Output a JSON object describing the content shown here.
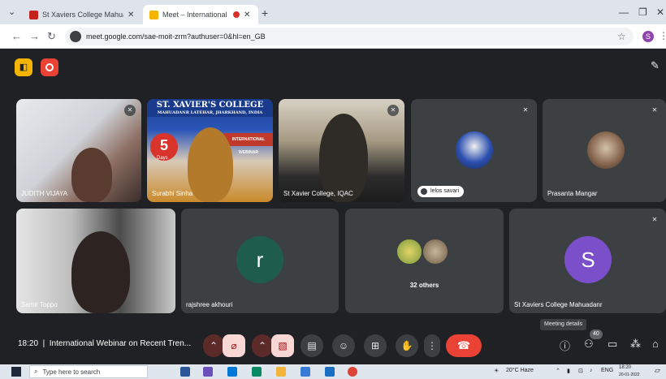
{
  "browser": {
    "tabs": [
      {
        "title": "St Xaviers College Mahuadanr |",
        "favicon_color": "#c5221f"
      },
      {
        "title": "Meet – International Webin",
        "favicon_color": "#f5b400",
        "active": true
      }
    ],
    "url": "meet.google.com/sae-moit-zrm?authuser=0&hl=en_GB"
  },
  "participants": [
    {
      "name": "JUDITH VIJAYA",
      "muted": true
    },
    {
      "name": "Surabhi Sinha",
      "muted": false
    },
    {
      "name": "St Xavier College, IQAC",
      "muted": true
    },
    {
      "name": "lelos savari",
      "muted": true
    },
    {
      "name": "Prasanta Mangar",
      "muted": true
    },
    {
      "name": "Samir Toppo",
      "muted": false
    },
    {
      "name": "rajshree akhouri",
      "initial": "r",
      "color": "#1e5c4e"
    },
    {
      "name": "32 others"
    },
    {
      "name": "St Xaviers College Mahuadanr",
      "initial": "S",
      "color": "#7b4fc9",
      "muted": true
    }
  ],
  "banner": {
    "title": "ST. XAVIER'S COLLEGE",
    "line1": "MAHUADANR",
    "line2": "LATEHAR, JHARKHAND, INDIA",
    "days_num": "5",
    "days_label": "Days",
    "intl": "INTERNATIONAL WEBINAR"
  },
  "bottom_bar": {
    "time": "18:20",
    "separator": "|",
    "meeting_title": "International Webinar on Recent Tren...",
    "tooltip": "Meeting details",
    "people_count": "40"
  },
  "taskbar": {
    "search_placeholder": "Type here to search",
    "weather": "20°C Haze",
    "lang": "ENG",
    "clock_time": "18:20",
    "clock_date": "20-01-2022"
  }
}
